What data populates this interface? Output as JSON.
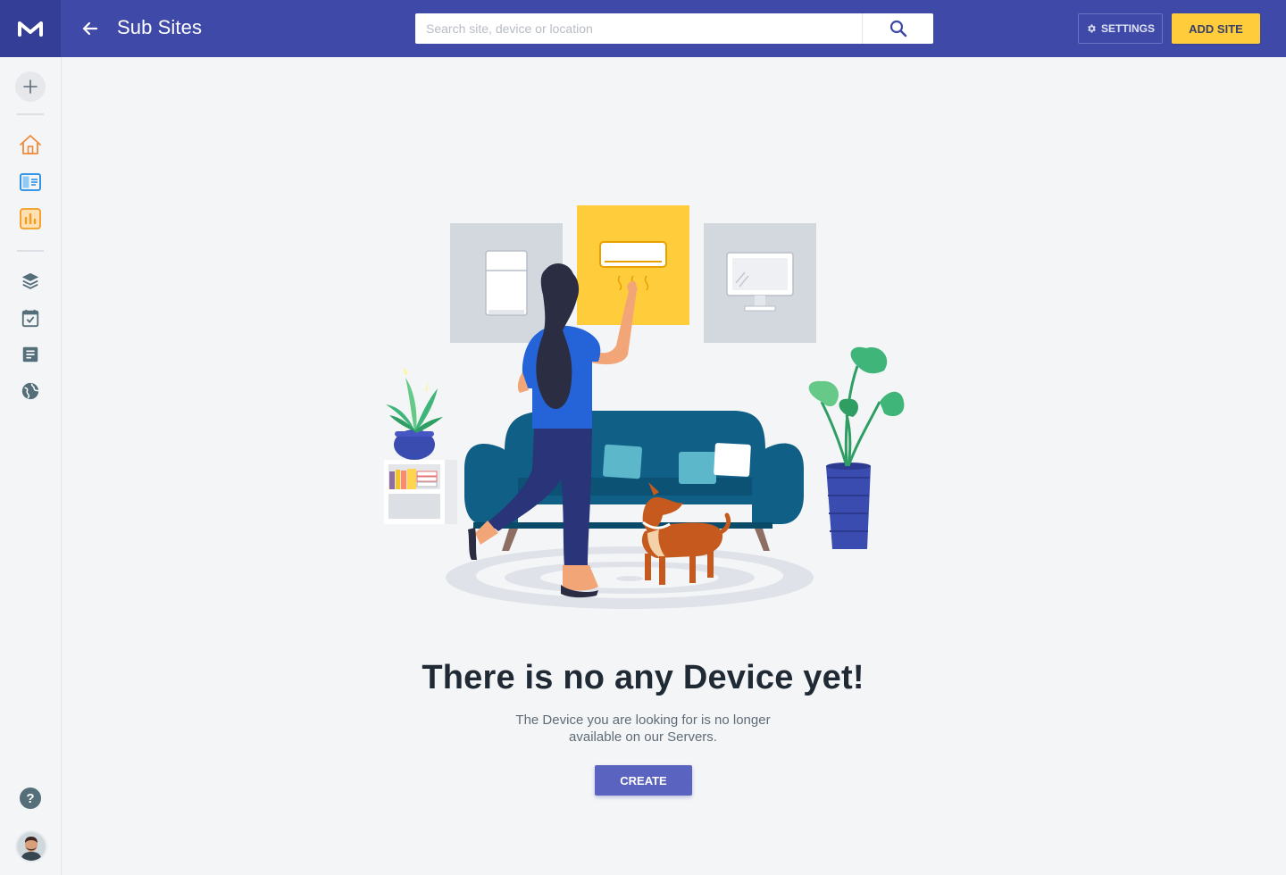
{
  "header": {
    "title": "Sub Sites",
    "search_placeholder": "Search site, device or location",
    "settings_label": "SETTINGS",
    "add_site_label": "ADD SITE"
  },
  "sidebar": {
    "items": [
      {
        "icon": "plus-icon"
      },
      {
        "icon": "home-icon"
      },
      {
        "icon": "devices-icon"
      },
      {
        "icon": "chart-icon"
      },
      {
        "icon": "layers-icon"
      },
      {
        "icon": "calendar-check-icon"
      },
      {
        "icon": "document-icon"
      },
      {
        "icon": "globe-icon"
      },
      {
        "icon": "help-icon"
      }
    ]
  },
  "empty_state": {
    "title": "There is no any Device yet!",
    "description_line1": "The Device you are looking for is no longer",
    "description_line2": "available on our Servers.",
    "create_label": "CREATE"
  },
  "colors": {
    "topbar": "#3f4aa8",
    "accent_yellow": "#ffcd3c",
    "create_button": "#5b63c1",
    "sofa": "#0f5f86"
  }
}
